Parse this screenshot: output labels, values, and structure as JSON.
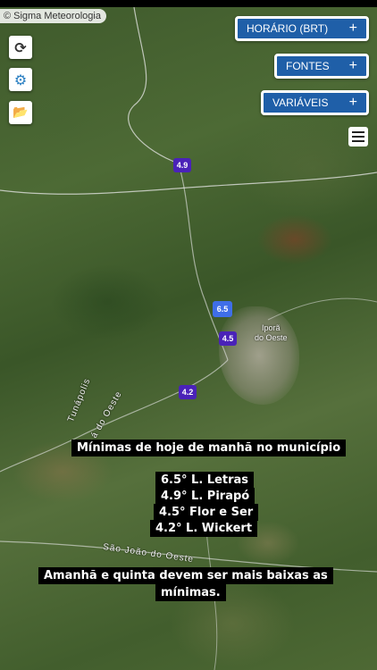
{
  "credit": {
    "symbol": "©",
    "text": "Sigma Meteorologia"
  },
  "controls": {
    "refresh_icon": "⟳",
    "settings_icon": "⚙",
    "folder_icon": "📂"
  },
  "buttons": {
    "horario": {
      "label": "HORÁRIO (BRT)",
      "plus": "+"
    },
    "fontes": {
      "label": "FONTES",
      "plus": "+"
    },
    "variaveis": {
      "label": "VARIÁVEIS",
      "plus": "+"
    }
  },
  "markers": [
    {
      "value": "4.9",
      "color": "#4a22b8"
    },
    {
      "value": "6.5",
      "color": "#3f6ee8"
    },
    {
      "value": "4.5",
      "color": "#4a22b8"
    },
    {
      "value": "4.2",
      "color": "#4a22b8"
    }
  ],
  "map_labels": {
    "town_line1": "Iporã",
    "town_line2": "do Oeste",
    "road1": "Tunápolis",
    "road2": "á do Oeste",
    "road3": "São João do Oeste"
  },
  "captions": {
    "headline": "Mínimas de hoje de manhã no município",
    "lines": [
      "6.5° L. Letras",
      "4.9° L. Pirapó",
      "4.5° Flor e Ser",
      "4.2° L. Wickert"
    ],
    "footer_line1": "Amanhã e quinta devem ser mais baixas as",
    "footer_line2": "mínimas."
  }
}
